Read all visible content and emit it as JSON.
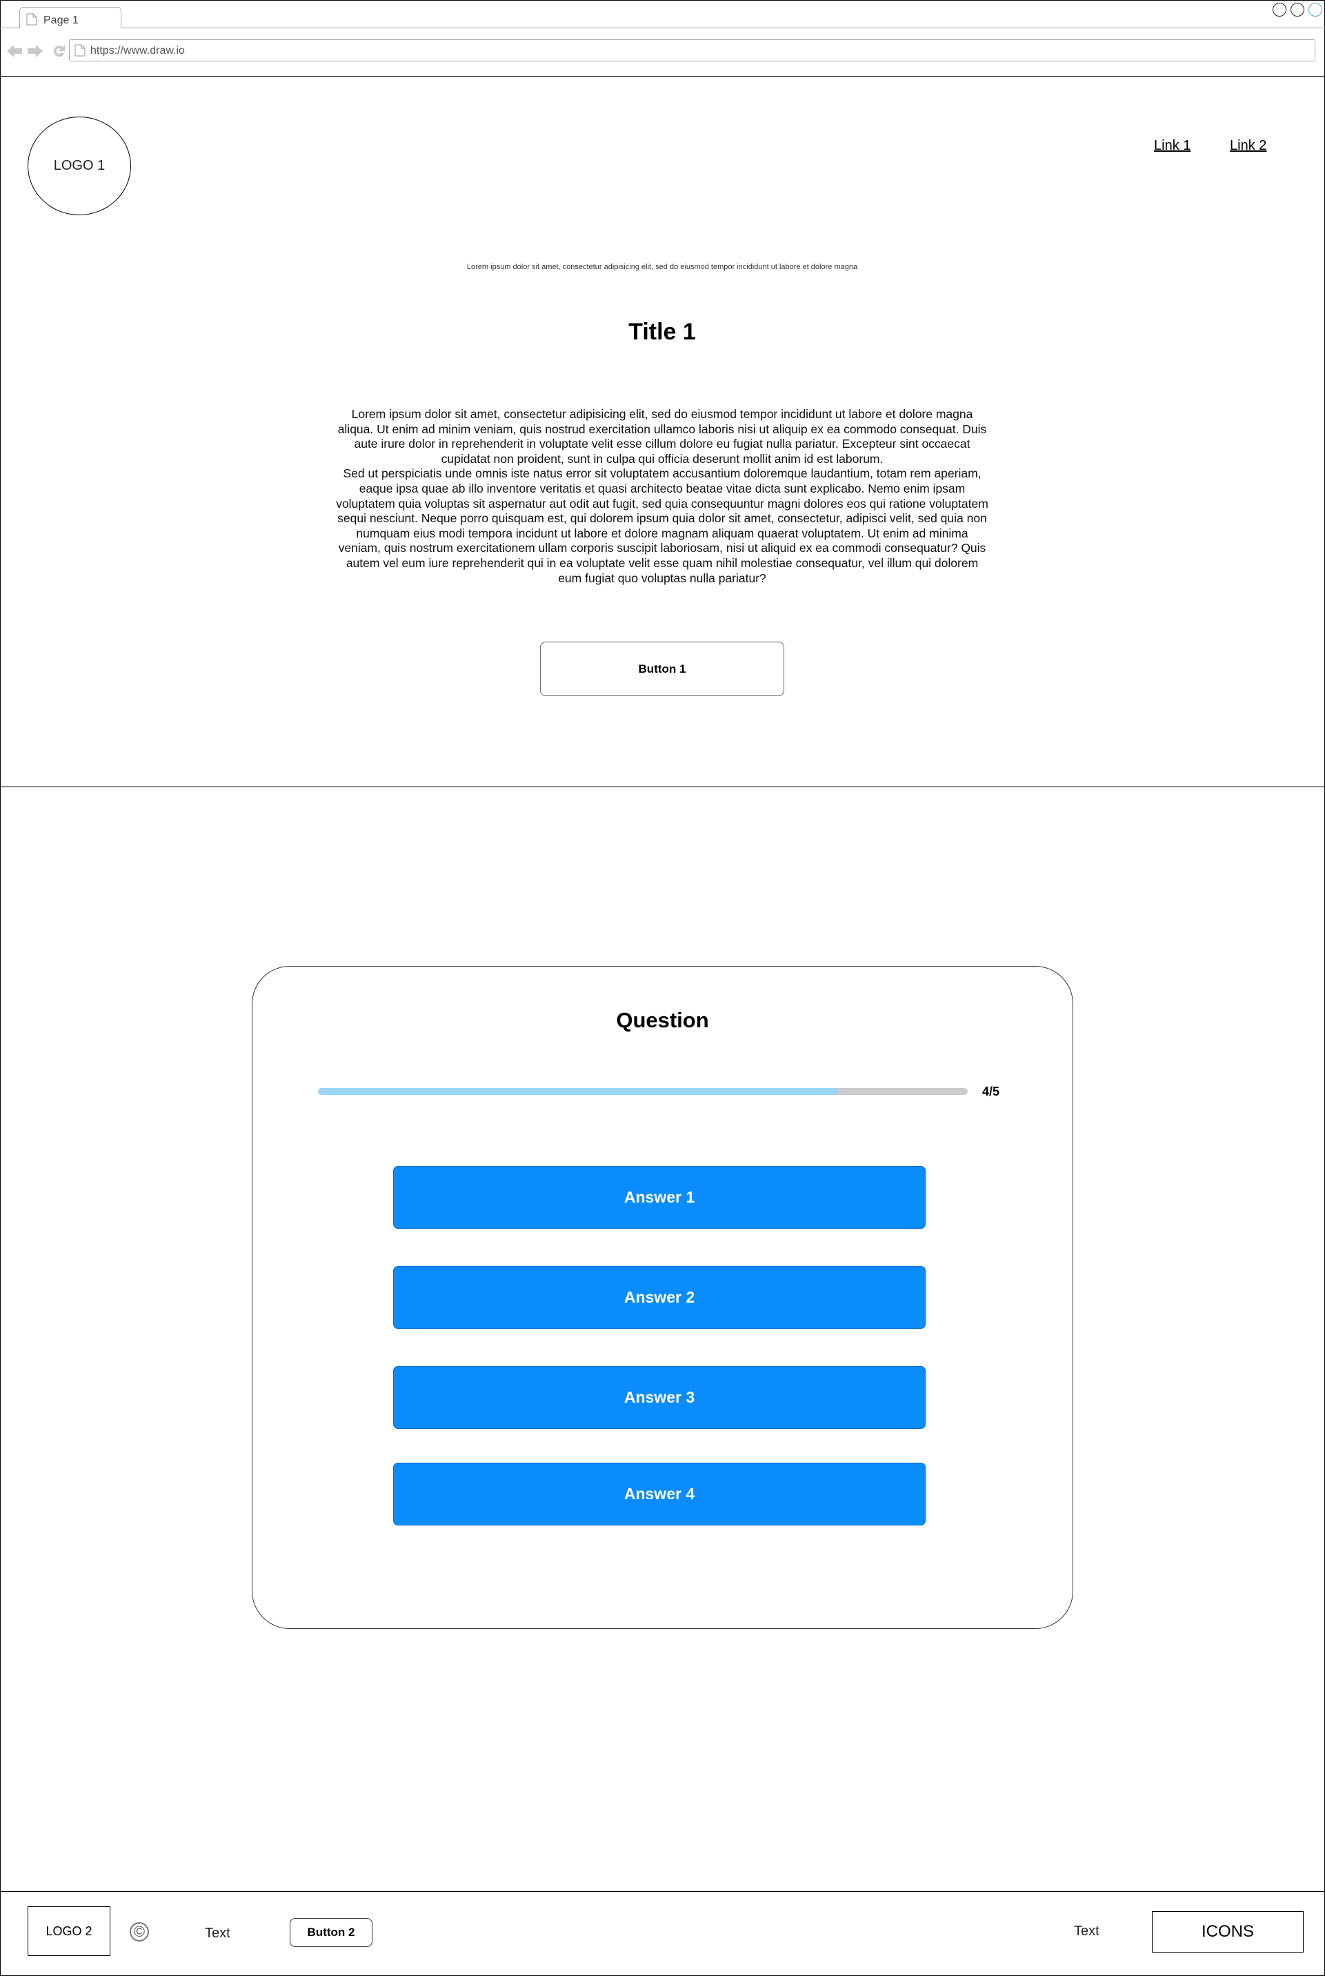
{
  "browser": {
    "tab_label": "Page 1",
    "url": "https://www.draw.io",
    "window_button_colors": [
      "#222222",
      "#222222",
      "#4aa8d8"
    ]
  },
  "header": {
    "logo": "LOGO 1",
    "links": [
      "Link 1",
      "Link 2"
    ]
  },
  "hero": {
    "intro": "Lorem ipsum dolor sit amet, consectetur adipisicing elit, sed do eiusmod tempor incididunt ut labore et dolore magna",
    "title": "Title 1",
    "paragraphs": [
      "Lorem ipsum dolor sit amet, consectetur adipisicing elit, sed do eiusmod tempor incididunt ut labore et dolore magna aliqua. Ut enim ad minim veniam, quis nostrud exercitation ullamco laboris nisi ut aliquip ex ea commodo consequat. Duis aute irure dolor in reprehenderit in voluptate velit esse cillum dolore eu fugiat nulla pariatur. Excepteur sint occaecat cupidatat non proident, sunt in culpa qui officia deserunt mollit anim id est laborum.",
      "Sed ut perspiciatis unde omnis iste natus error sit voluptatem accusantium doloremque laudantium, totam rem aperiam, eaque ipsa quae ab illo inventore veritatis et quasi architecto beatae vitae dicta sunt explicabo. Nemo enim ipsam voluptatem quia voluptas sit aspernatur aut odit aut fugit, sed quia consequuntur magni dolores eos qui ratione voluptatem sequi nesciunt. Neque porro quisquam est, qui dolorem ipsum quia dolor sit amet, consectetur, adipisci velit, sed quia non numquam eius modi tempora incidunt ut labore et dolore magnam aliquam quaerat voluptatem. Ut enim ad minima veniam, quis nostrum exercitationem ullam corporis suscipit laboriosam, nisi ut aliquid ex ea commodi consequatur? Quis autem vel eum iure reprehenderit qui in ea voluptate velit esse quam nihil molestiae consequatur, vel illum qui dolorem eum fugiat quo voluptas nulla pariatur?"
    ],
    "button": "Button 1"
  },
  "quiz": {
    "question": "Question",
    "progress_label": "4/5",
    "progress_fraction": 0.8,
    "progress_colors": {
      "fill": "#99d6f6",
      "track": "#cccccc"
    },
    "answer_color": "#0a8cfd",
    "answers": [
      "Answer 1",
      "Answer 2",
      "Answer 3",
      "Answer 4"
    ]
  },
  "footer": {
    "logo": "LOGO 2",
    "copyright_icon": "copyright-icon",
    "text_left": "Text",
    "button": "Button 2",
    "text_right": "Text",
    "icons_label": "ICONS"
  }
}
